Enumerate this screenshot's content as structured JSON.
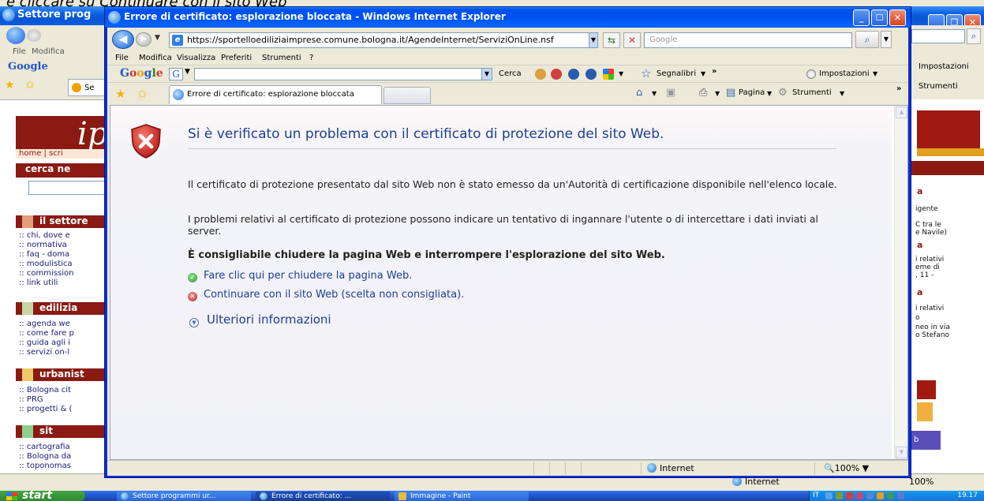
{
  "caption": "e cliccare su Continuare con il sito Web",
  "background_window": {
    "title": "Settore prog",
    "menu": [
      "File",
      "Modifica"
    ],
    "google_label": "Google",
    "tab_label": "Se",
    "settings_label": "Impostazioni",
    "tools_label": "Strumenti",
    "status_internet": "Internet",
    "status_zoom": "100%",
    "left_page": {
      "logo": "ip",
      "home_bar": "home | scri",
      "search_heading": "cerca ne",
      "sections": [
        {
          "title": "il settore",
          "color": "#e0a07a",
          "links": [
            ":: chi, dove e",
            ":: normativa",
            ":: faq - doma",
            ":: modulistica",
            ":: commission",
            ":: link utili"
          ]
        },
        {
          "title": "edilizia",
          "color": "#c7d6a3",
          "links": [
            ":: agenda we",
            ":: come fare p",
            ":: guida agli i",
            ":: servizi on-l"
          ]
        },
        {
          "title": "urbanist",
          "color": "#f2c86a",
          "links": [
            ":: Bologna cit",
            ":: PRG",
            ":: progetti & ("
          ]
        },
        {
          "title": "sit",
          "color": "#8fcf8f",
          "links": [
            ":: cartografia",
            ":: Bologna da",
            ":: toponomas"
          ]
        }
      ]
    },
    "right_page": {
      "lines": [
        "a",
        "igente",
        "C tra le",
        "e Navile)",
        "a",
        "i relativi",
        "eme di",
        ", 11 -",
        "a",
        "i relativi",
        "o",
        "neo in via",
        "o Stefano",
        "b"
      ]
    }
  },
  "window": {
    "title": "Errore di certificato: esplorazione bloccata - Windows Internet Explorer",
    "address": "https://sportelloediliziaimprese.comune.bologna.it/AgendeInternet/ServiziOnLine.nsf",
    "search_placeholder": "Google",
    "menu": [
      "File",
      "Modifica",
      "Visualizza",
      "Preferiti",
      "Strumenti",
      "?"
    ],
    "google_toolbar": {
      "cerca": "Cerca",
      "segnalibri": "Segnalibri",
      "chevron": "»",
      "impostazioni": "Impostazioni"
    },
    "tab_title": "Errore di certificato: esplorazione bloccata",
    "tab_tools": {
      "pagina": "Pagina",
      "strumenti": "Strumenti",
      "chevron": "»"
    },
    "content": {
      "heading": "Si è verificato un problema con il certificato di protezione del sito Web.",
      "para1": "Il certificato di protezione presentato dal sito Web non è stato emesso da un'Autorità di certificazione disponibile nell'elenco locale.",
      "para2": "I problemi relativi al certificato di protezione possono indicare un tentativo di ingannare l'utente o di intercettare i dati inviati al server.",
      "recommendation": "È consigliabile chiudere la pagina Web e interrompere l'esplorazione del sito Web.",
      "close_link": "Fare clic qui per chiudere la pagina Web.",
      "continue_link": "Continuare con il sito Web (scelta non consigliata).",
      "more_info": "Ulteriori informazioni"
    },
    "status": {
      "zone": "Internet",
      "zoom": "100%"
    }
  },
  "taskbar": {
    "start": "start",
    "items": [
      "Settore programmi ur...",
      "Errore di certificato: ...",
      "Immagine - Paint"
    ],
    "lang": "IT",
    "clock": "19.17"
  },
  "colors": {
    "title_blue": "#0053ee",
    "link_blue": "#1c3f94",
    "error_red": "#c02020",
    "brand_red": "#8a1a12"
  }
}
